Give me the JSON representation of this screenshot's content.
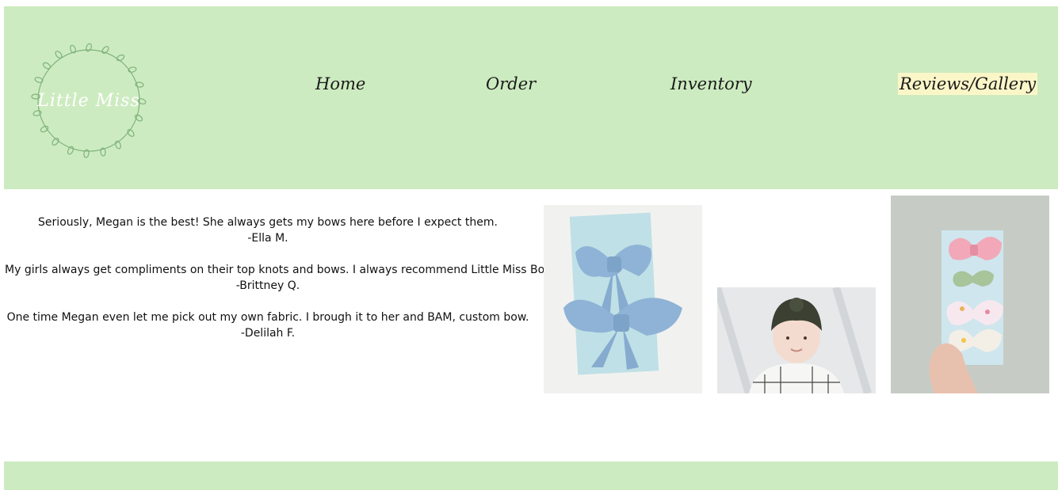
{
  "brand": {
    "logo_text": "Little Miss",
    "logo_icon": "laurel-wreath-icon"
  },
  "nav": {
    "home": "Home",
    "order": "Order",
    "inventory": "Inventory",
    "reviews": "Reviews/Gallery"
  },
  "reviews": [
    {
      "quote": "Seriously, Megan is the best! She always gets my bows here before I expect them.",
      "author": "-Ella M."
    },
    {
      "quote": "My girls always get compliments on their top knots and bows. I always recommend Little Miss Bowtique.",
      "author": "-Brittney Q."
    },
    {
      "quote": "One time Megan even let me pick out my own fabric. I brough it to her and BAM, custom bow.",
      "author": "-Delilah F."
    }
  ],
  "gallery": {
    "photo1_icon": "blue-bows-photo",
    "photo2_icon": "baby-turban-photo",
    "photo3_icon": "floral-bows-photo"
  },
  "colors": {
    "header_bg": "#cdebc0",
    "active_nav_bg": "#fbf6c8"
  }
}
